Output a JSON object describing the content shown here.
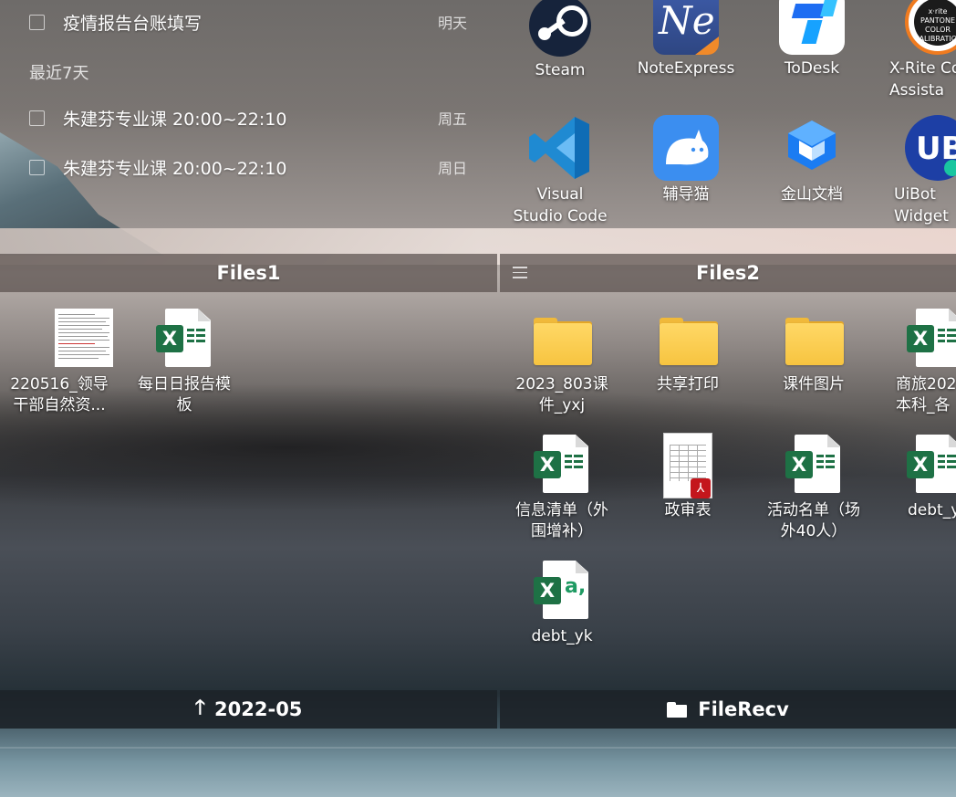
{
  "todo": {
    "items_top": [
      {
        "label": "疫情报告台账填写",
        "when": "明天"
      }
    ],
    "section_label": "最近7天",
    "items_recent": [
      {
        "label": "朱建芬专业课 20:00~22:10",
        "when": "周五"
      },
      {
        "label": "朱建芬专业课 20:00~22:10",
        "when": "周日"
      }
    ]
  },
  "shortcuts": [
    {
      "label": "Steam",
      "icon": "steam-icon"
    },
    {
      "label": "NoteExpress",
      "icon": "noteexpress-icon"
    },
    {
      "label": "ToDesk",
      "icon": "todesk-icon"
    },
    {
      "label": "X-Rite Co",
      "label2": "Assista",
      "icon": "xrite-icon",
      "inner_text": "x·rite PANTONE COLOR CALIBRATION"
    },
    {
      "label": "Visual",
      "label2": "Studio Code",
      "icon": "vscode-icon"
    },
    {
      "label": "辅导猫",
      "icon": "fudaomao-icon"
    },
    {
      "label": "金山文档",
      "icon": "kingsoft-docs-icon"
    },
    {
      "label": "UiBot",
      "label2": "Widget",
      "icon": "uibot-icon",
      "inner_text": "UB"
    }
  ],
  "files1": {
    "title": "Files1",
    "footer": "2022-05",
    "items": [
      {
        "label": "220516_领导",
        "label2": "干部自然资...",
        "icon": "document-thumbnail-icon"
      },
      {
        "label": "每日日报告模",
        "label2": "板",
        "icon": "excel-icon"
      }
    ]
  },
  "files2": {
    "title": "Files2",
    "footer": "FileRecv",
    "items": [
      {
        "label": "2023_803课",
        "label2": "件_yxj",
        "icon": "folder-icon"
      },
      {
        "label": "共享打印",
        "label2": "",
        "icon": "folder-icon"
      },
      {
        "label": "课件图片",
        "label2": "",
        "icon": "folder-icon"
      },
      {
        "label": "商旅202",
        "label2": "本科_各",
        "icon": "excel-icon"
      },
      {
        "label": "信息清单（外",
        "label2": "围增补）",
        "icon": "excel-icon"
      },
      {
        "label": "政审表",
        "label2": "",
        "icon": "pdf-icon"
      },
      {
        "label": "活动名单（场",
        "label2": "外40人）",
        "icon": "excel-icon"
      },
      {
        "label": "debt_y",
        "label2": "",
        "icon": "excel-icon"
      },
      {
        "label": "debt_yk",
        "label2": "",
        "icon": "excel-csv-icon",
        "badge_text": "X",
        "csv_text": "a,"
      }
    ]
  },
  "colors": {
    "excel_green": "#1e7145",
    "folder_yellow": "#ffd866",
    "pdf_red": "#c4161c"
  }
}
